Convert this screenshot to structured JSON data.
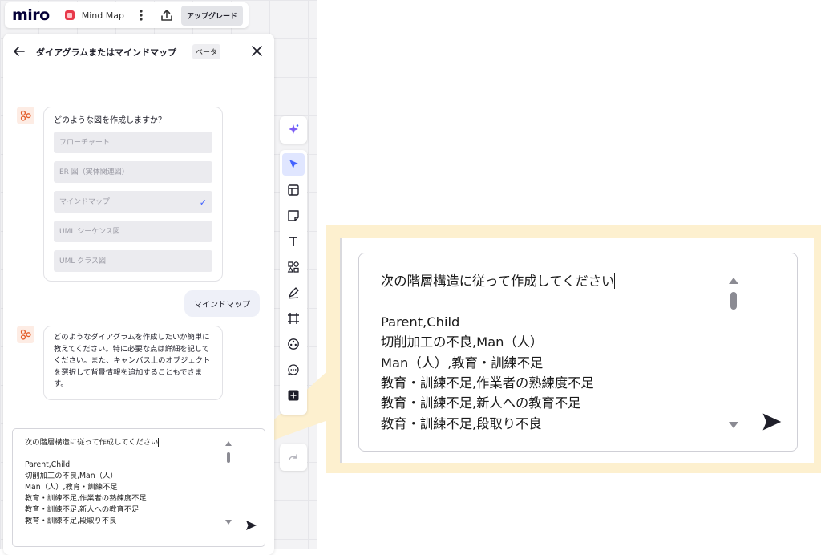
{
  "topbar": {
    "logo": "miro",
    "board_name": "Mind Map",
    "upgrade_label": "アップグレード"
  },
  "panel": {
    "title": "ダイアグラムまたはマインドマップ",
    "badge": "ベータ",
    "question": "どのような図を作成しますか？",
    "options": [
      {
        "label": "フローチャート",
        "selected": false
      },
      {
        "label": "ER 図（実体関連図）",
        "selected": false
      },
      {
        "label": "マインドマップ",
        "selected": true
      },
      {
        "label": "UML シーケンス図",
        "selected": false
      },
      {
        "label": "UML クラス図",
        "selected": false
      }
    ],
    "user_reply": "マインドマップ",
    "ai_message": "どのようなダイアグラムを作成したいか簡単に教えてください。特に必要な点は詳細を記してください。また、キャンバス上のオブジェクトを選択して背景情報を追加することもできます。"
  },
  "input": {
    "first_line": "次の階層構造に従って作成してください",
    "lines": [
      "",
      "Parent,Child",
      "切削加工の不良,Man（人）",
      "Man（人）,教育・訓練不足",
      "教育・訓練不足,作業者の熟練度不足",
      "教育・訓練不足,新人への教育不足",
      "教育・訓練不足,段取り不良"
    ]
  },
  "toolbar": {
    "tools": [
      "ai-sparkle-icon",
      "select-cursor-icon",
      "templates-icon",
      "sticky-note-icon",
      "text-icon",
      "shapes-icon",
      "pen-icon",
      "frame-icon",
      "apps-icon",
      "comment-icon",
      "add-icon"
    ],
    "active_tool": "select-cursor-icon"
  },
  "colors": {
    "accent": "#4262ff",
    "callout": "#fdf0cf",
    "ai_avatar": "#fdece4"
  }
}
